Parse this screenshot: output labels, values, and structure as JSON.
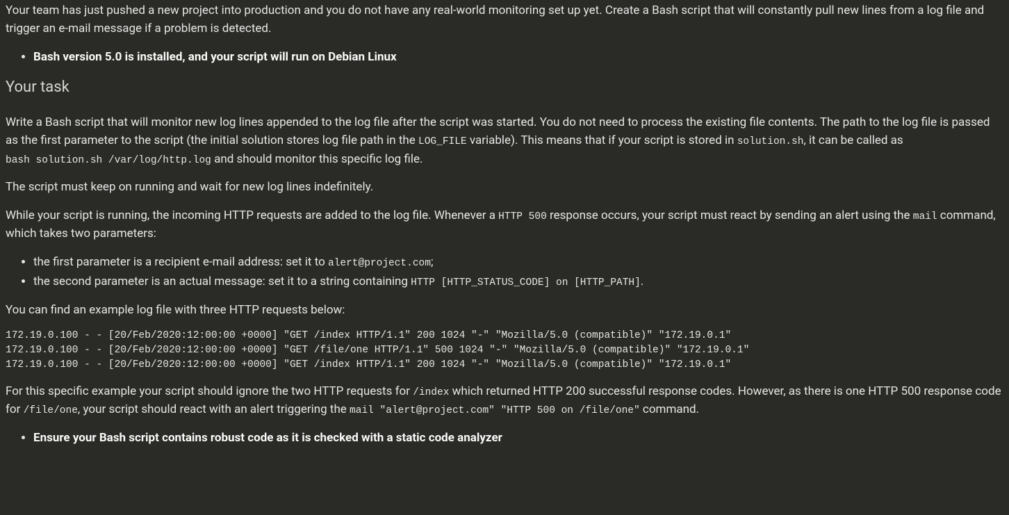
{
  "intro": {
    "p1": "Your team has just pushed a new project into production and you do not have any real-world monitoring set up yet. Create a Bash script that will constantly pull new lines from a log file and trigger an e-mail message if a problem is detected.",
    "bullet1": "Bash version 5.0 is installed, and your script will run on Debian Linux"
  },
  "task": {
    "heading": "Your task",
    "p1_a": "Write a Bash script that will monitor new log lines appended to the log file after the script was started. You do not need to process the existing file contents. The path to the log file is passed as the first parameter to the script (the initial solution stores log file path in the ",
    "p1_code1": "LOG_FILE",
    "p1_b": " variable). This means that if your script is stored in ",
    "p1_code2": "solution.sh",
    "p1_c": ", it can be called as ",
    "p1_code3": "bash solution.sh /var/log/http.log",
    "p1_d": " and should monitor this specific log file.",
    "p2": "The script must keep on running and wait for new log lines indefinitely.",
    "p3_a": "While your script is running, the incoming HTTP requests are added to the log file. Whenever a ",
    "p3_code1": "HTTP 500",
    "p3_b": " response occurs, your script must react by sending an alert using the ",
    "p3_code2": "mail",
    "p3_c": " command, which takes two parameters:",
    "params": {
      "li1_a": "the first parameter is a recipient e-mail address: set it to ",
      "li1_code": "alert@project.com",
      "li1_b": ";",
      "li2_a": "the second parameter is an actual message: set it to a string containing ",
      "li2_code": "HTTP [HTTP_STATUS_CODE] on [HTTP_PATH]",
      "li2_b": "."
    },
    "p4": "You can find an example log file with three HTTP requests below:",
    "pre": "172.19.0.100 - - [20/Feb/2020:12:00:00 +0000] \"GET /index HTTP/1.1\" 200 1024 \"-\" \"Mozilla/5.0 (compatible)\" \"172.19.0.1\"\n172.19.0.100 - - [20/Feb/2020:12:00:00 +0000] \"GET /file/one HTTP/1.1\" 500 1024 \"-\" \"Mozilla/5.0 (compatible)\" \"172.19.0.1\"\n172.19.0.100 - - [20/Feb/2020:12:00:00 +0000] \"GET /index HTTP/1.1\" 200 1024 \"-\" \"Mozilla/5.0 (compatible)\" \"172.19.0.1\"",
    "p5_a": "For this specific example your script should ignore the two HTTP requests for ",
    "p5_code1": "/index",
    "p5_b": " which returned HTTP 200 successful response codes. However, as there is one HTTP 500 response code for ",
    "p5_code2": "/file/one",
    "p5_c": ", your script should react with an alert triggering the ",
    "p5_code3": "mail \"alert@project.com\" \"HTTP 500 on /file/one\"",
    "p5_d": " command.",
    "bullet_last": "Ensure your Bash script contains robust code as it is checked with a static code analyzer"
  }
}
